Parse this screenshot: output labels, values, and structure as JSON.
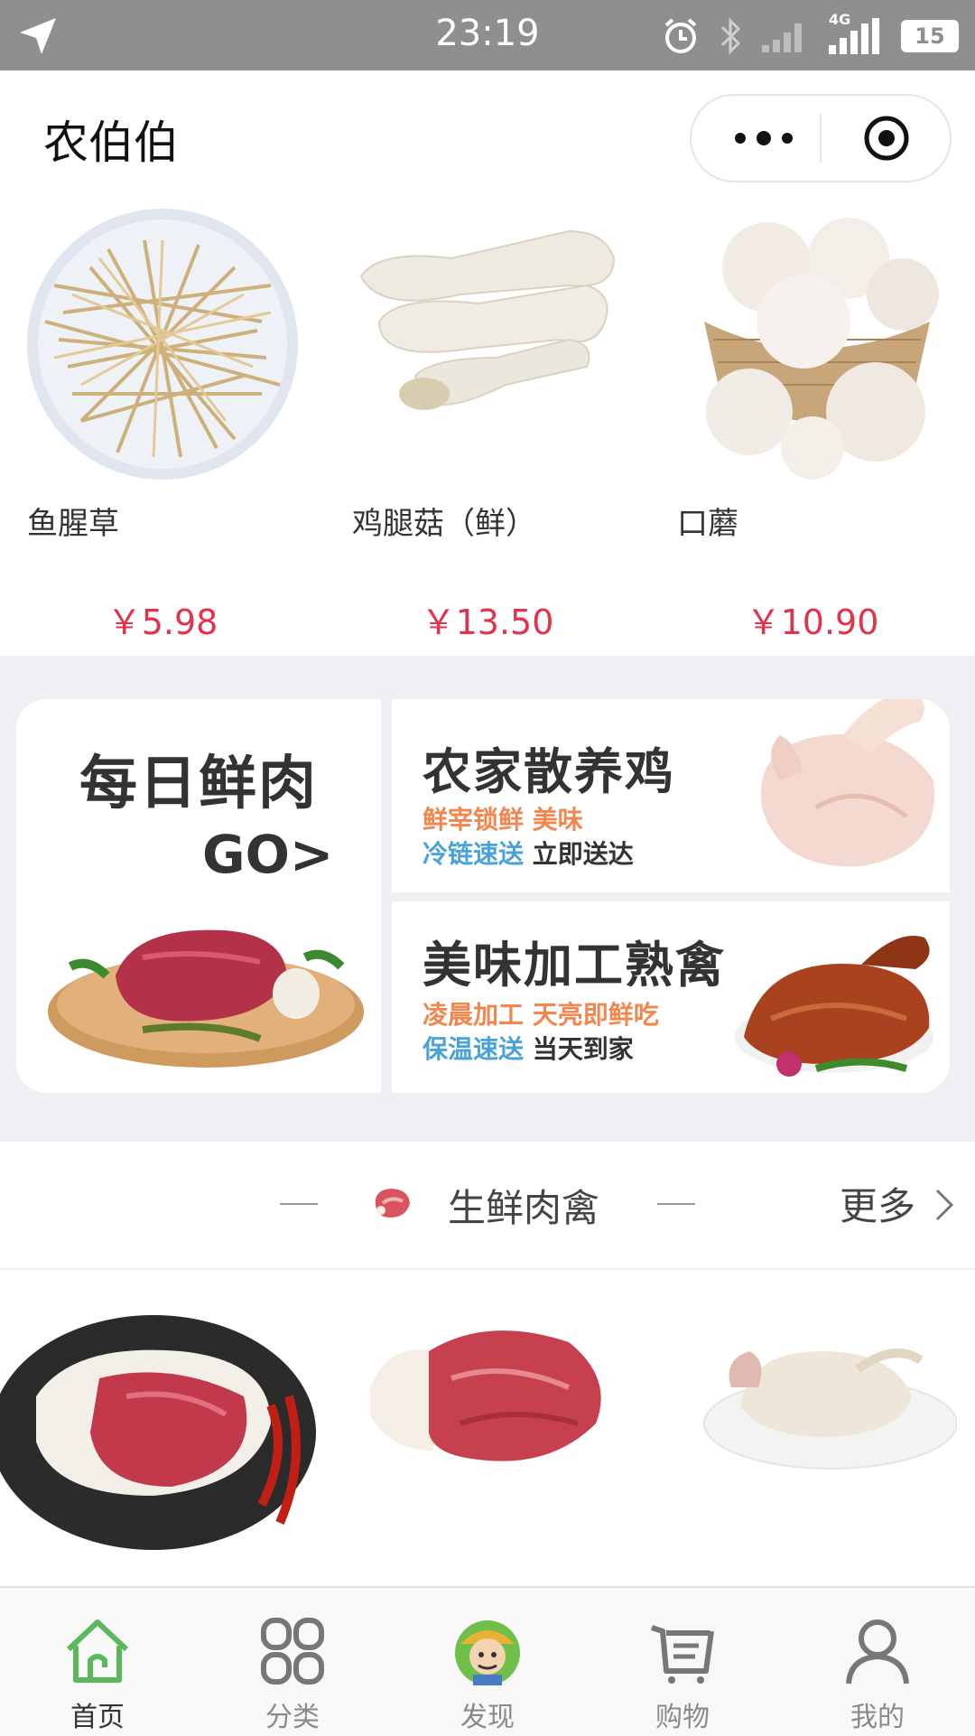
{
  "status_bar": {
    "time": "23:19",
    "network": "4G",
    "battery": "15",
    "icons": [
      "location-arrow-icon",
      "alarm-icon",
      "bluetooth-icon",
      "signal-icon",
      "battery-icon"
    ]
  },
  "header": {
    "title": "农伯伯",
    "menu_icon": "more-dots-icon",
    "close_icon": "target-close-icon"
  },
  "featured_products": [
    {
      "name": "鱼腥草",
      "price": "￥5.98"
    },
    {
      "name": "鸡腿菇（鲜）",
      "price": "￥13.50"
    },
    {
      "name": "口蘑",
      "price": "￥10.90"
    }
  ],
  "banner": {
    "left_title": "每日鲜肉",
    "left_cta": "GO>",
    "block1": {
      "title": "农家散养鸡",
      "line1_a": "鲜宰锁鲜 美味",
      "line2_a": "冷链速送",
      "line2_b": " 立即送达"
    },
    "block2": {
      "title": "美味加工熟禽",
      "line1_a": "凌晨加工 天亮即鲜吃",
      "line2_a": "保温速送",
      "line2_b": " 当天到家"
    }
  },
  "section": {
    "title": "生鲜肉禽",
    "more_label": "更多"
  },
  "tabs": [
    {
      "label": "首页",
      "icon": "home-icon",
      "active": true
    },
    {
      "label": "分类",
      "icon": "category-grid-icon",
      "active": false
    },
    {
      "label": "发现",
      "icon": "farmer-avatar-icon",
      "active": false
    },
    {
      "label": "购物",
      "icon": "cart-icon",
      "active": false
    },
    {
      "label": "我的",
      "icon": "user-icon",
      "active": false
    }
  ],
  "colors": {
    "price": "#e0334d",
    "tab_active": "#5cb85c",
    "status_bar": "#8f8f8f",
    "section_bg": "#efeff4"
  }
}
